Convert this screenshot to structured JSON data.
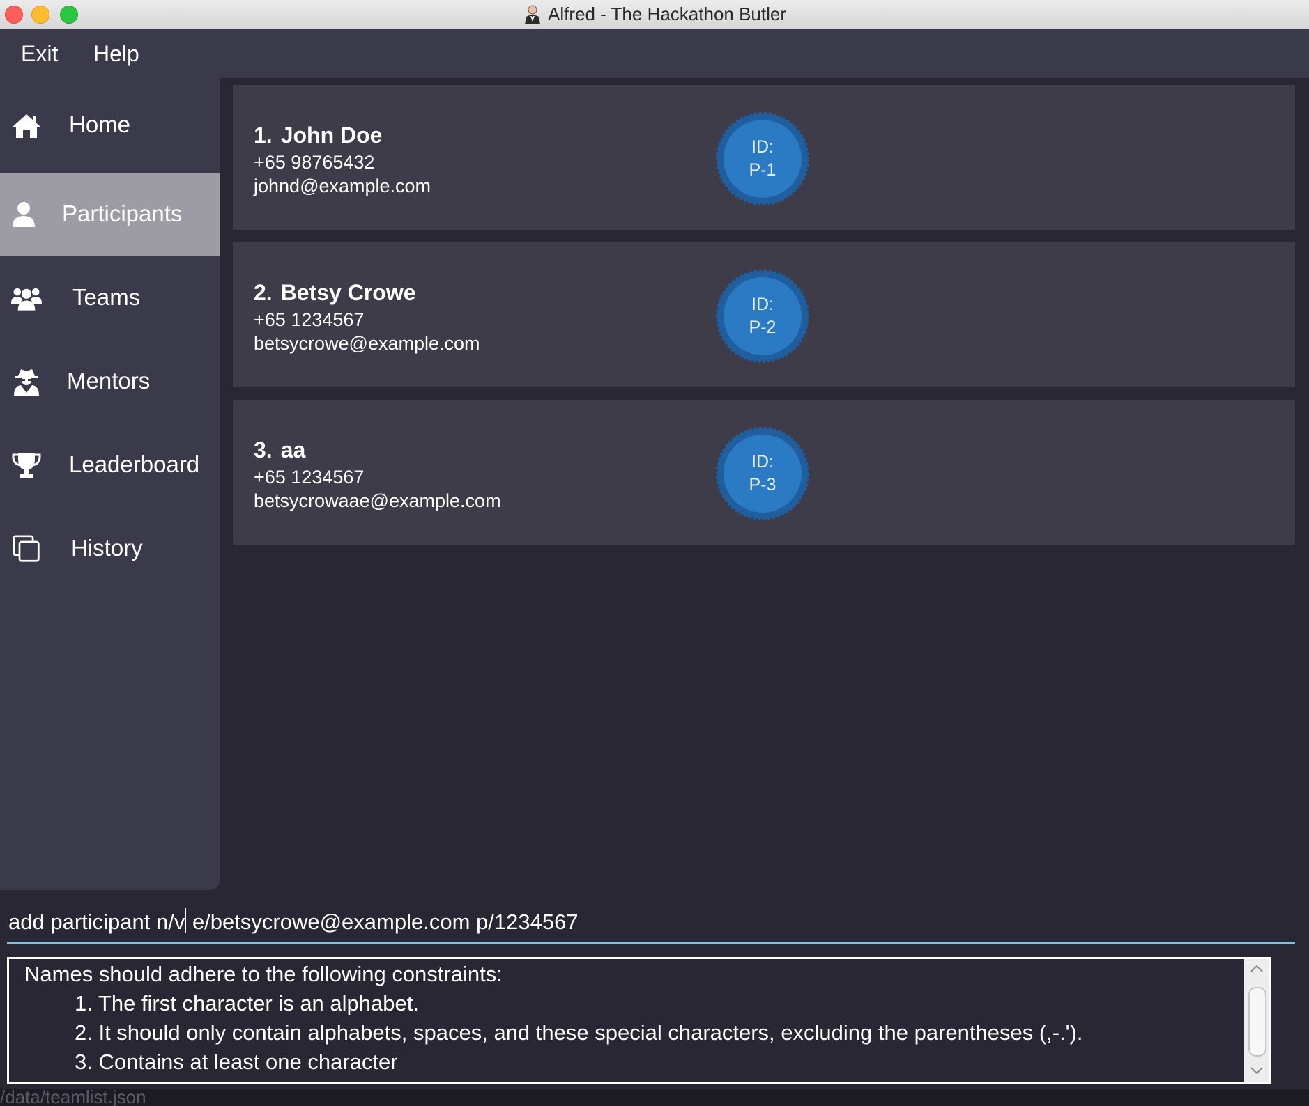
{
  "window": {
    "title": "Alfred - The Hackathon Butler"
  },
  "menu": {
    "items": [
      {
        "label": "Exit"
      },
      {
        "label": "Help"
      }
    ]
  },
  "sidebar": {
    "items": [
      {
        "label": "Home",
        "icon": "home-icon"
      },
      {
        "label": "Participants",
        "icon": "user-icon",
        "active": true
      },
      {
        "label": "Teams",
        "icon": "users-icon"
      },
      {
        "label": "Mentors",
        "icon": "user-secret-icon"
      },
      {
        "label": "Leaderboard",
        "icon": "trophy-icon"
      },
      {
        "label": "History",
        "icon": "copy-icon"
      }
    ]
  },
  "participants": [
    {
      "index": "1.",
      "name": "John Doe",
      "phone": "+65 98765432",
      "email": "johnd@example.com",
      "id_label": "ID:",
      "id": "P-1"
    },
    {
      "index": "2.",
      "name": "Betsy Crowe",
      "phone": "+65 1234567",
      "email": "betsycrowe@example.com",
      "id_label": "ID:",
      "id": "P-2"
    },
    {
      "index": "3.",
      "name": "aa",
      "phone": "+65 1234567",
      "email": "betsycrowaae@example.com",
      "id_label": "ID:",
      "id": "P-3"
    }
  ],
  "command": {
    "before_caret": "add participant n/v",
    "after_caret": " e/betsycrowe@example.com p/1234567"
  },
  "result": {
    "lines": [
      "Names should adhere to the following constraints:",
      "1. The first character is an alphabet.",
      "2. It should only contain alphabets, spaces, and these special characters, excluding the parentheses (,-.').",
      "3. Contains at least one character"
    ]
  },
  "status": {
    "path": "/data/teamlist.json"
  },
  "colors": {
    "background": "#282733",
    "panel": "#3b3a4b",
    "card": "#3d3c48",
    "active_nav": "#9d9ba3",
    "badge": "#2b7bc4",
    "command_underline": "#79c2e0"
  }
}
